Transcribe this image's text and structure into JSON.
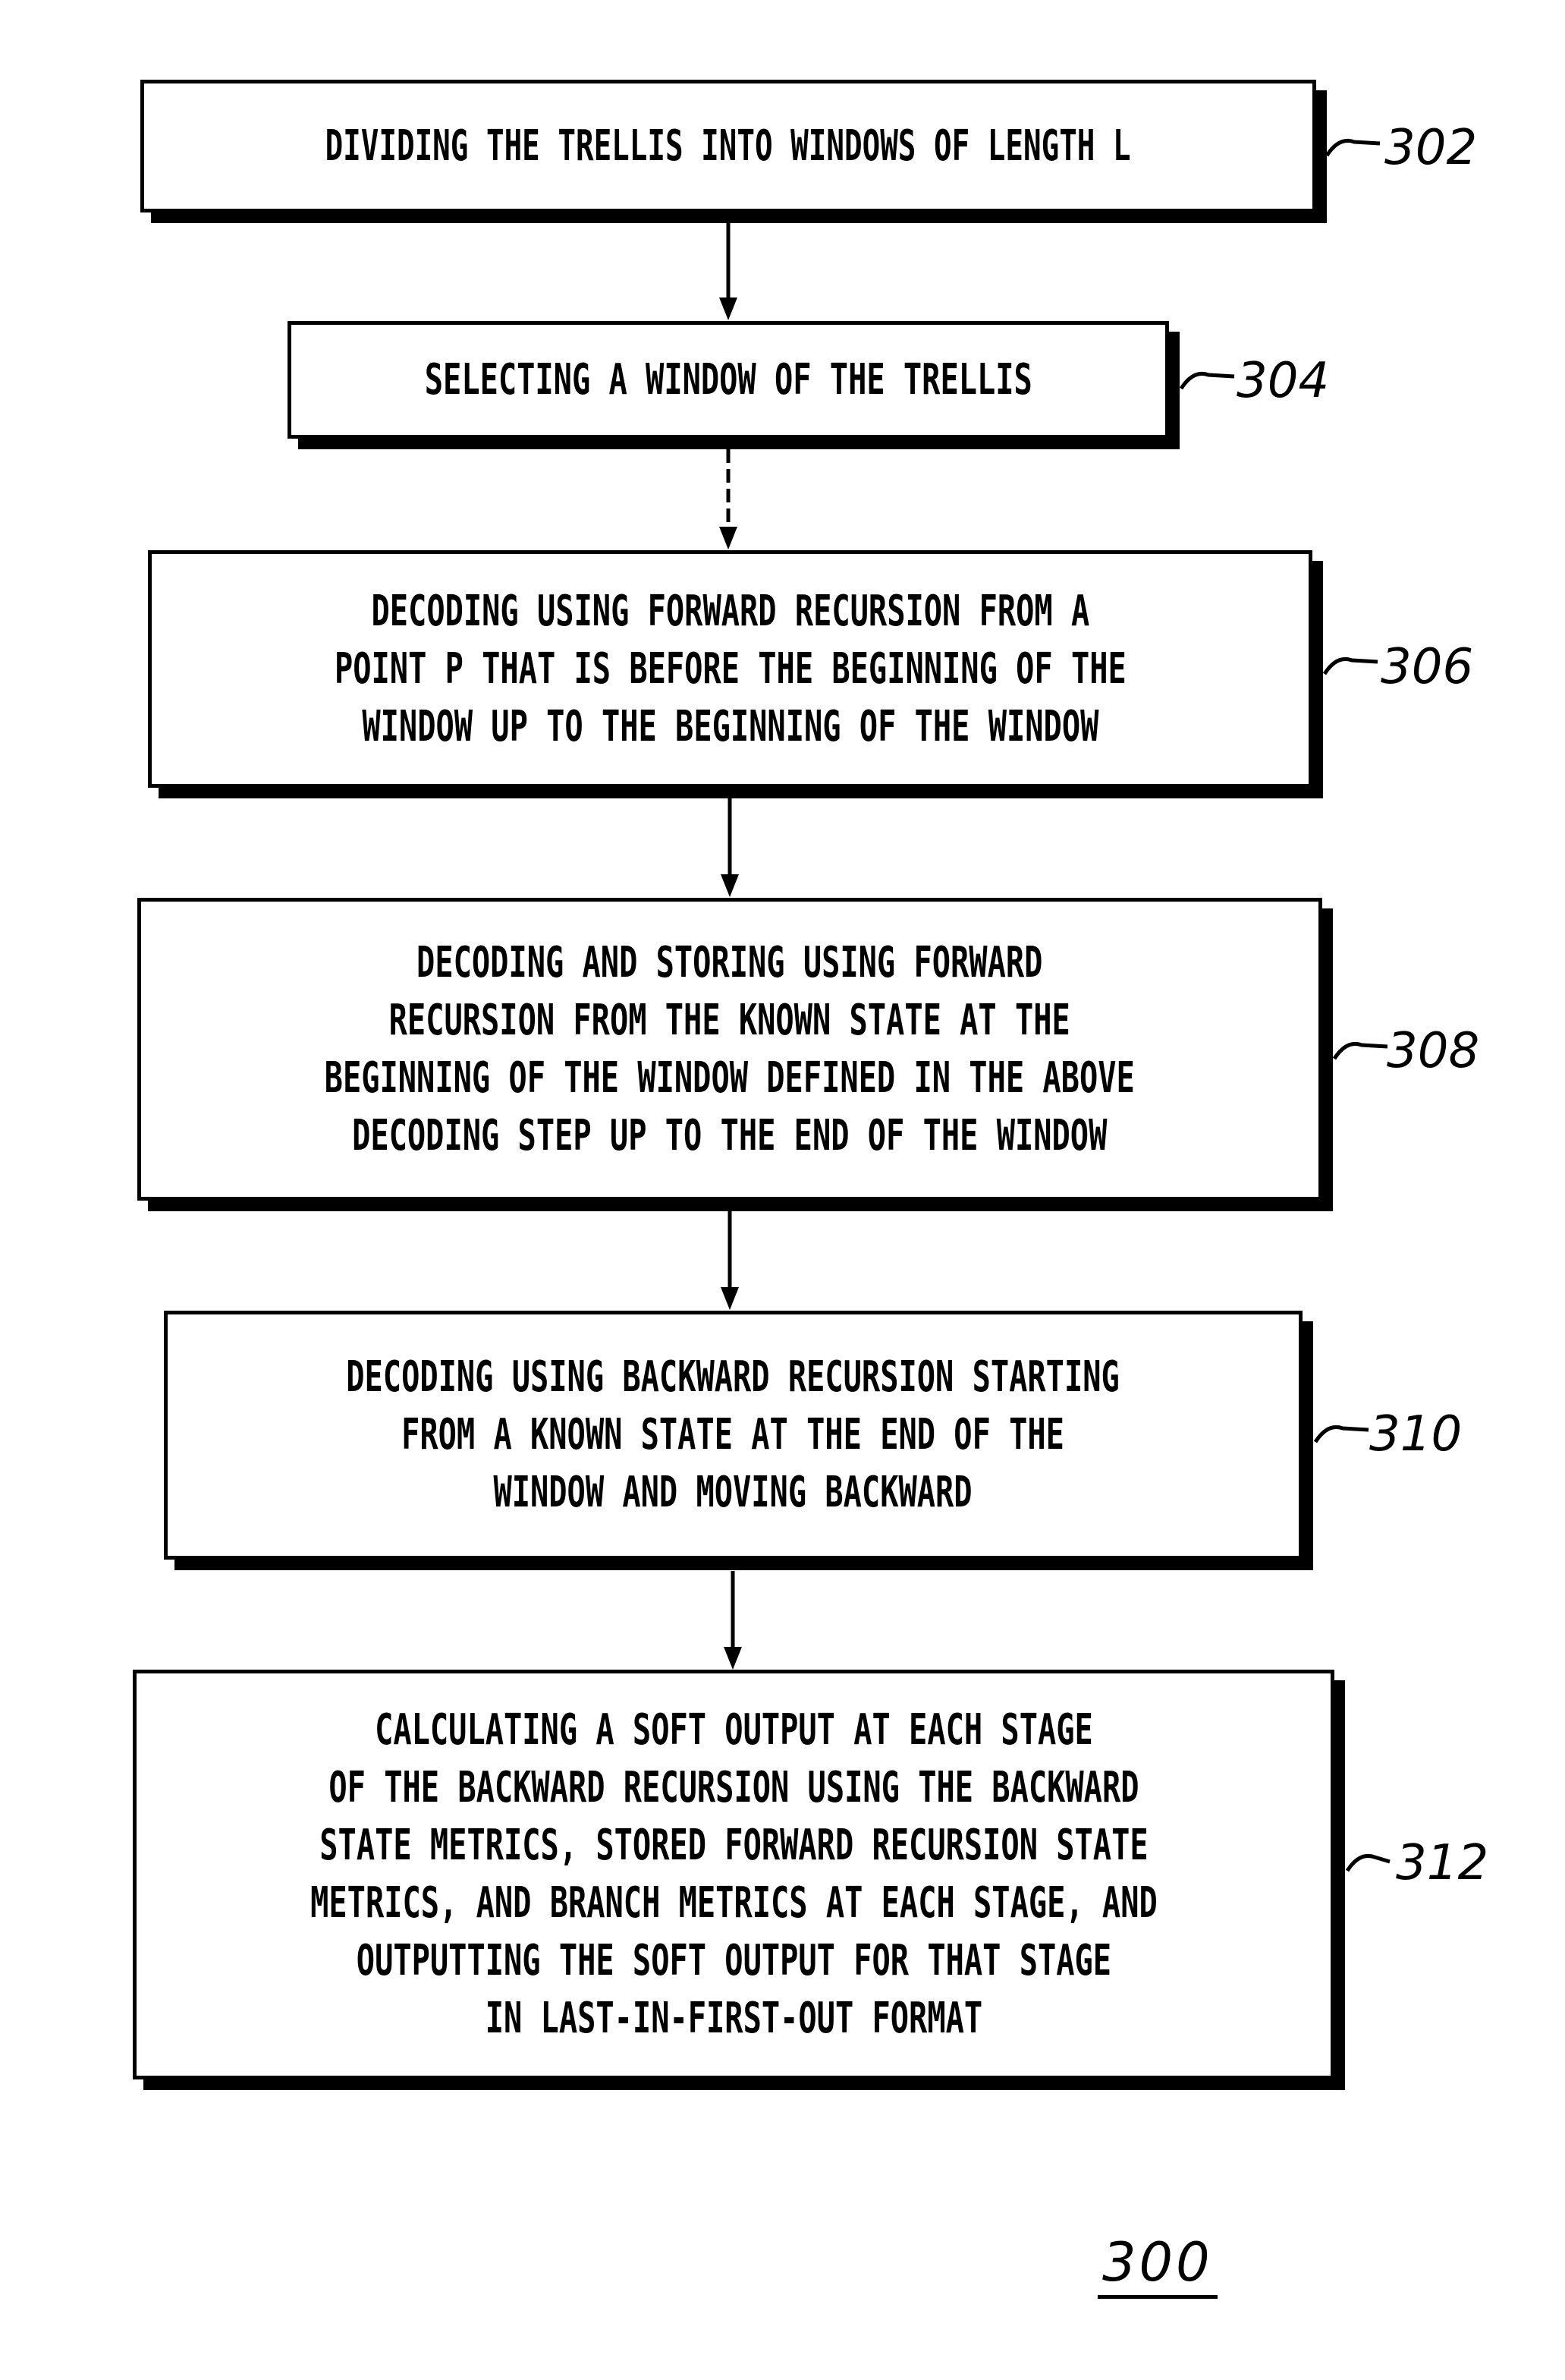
{
  "figure": {
    "label": "300",
    "steps": [
      {
        "ref": "302",
        "text": "DIVIDING THE TRELLIS INTO WINDOWS OF LENGTH L"
      },
      {
        "ref": "304",
        "text": "SELECTING A WINDOW OF THE TRELLIS"
      },
      {
        "ref": "306",
        "text": "DECODING USING FORWARD RECURSION FROM A\nPOINT P THAT IS BEFORE THE BEGINNING OF THE\nWINDOW UP TO THE BEGINNING OF THE WINDOW"
      },
      {
        "ref": "308",
        "text": "DECODING AND STORING USING FORWARD\nRECURSION FROM THE KNOWN STATE AT THE\nBEGINNING OF THE WINDOW DEFINED IN THE ABOVE\nDECODING STEP UP TO THE END OF THE WINDOW"
      },
      {
        "ref": "310",
        "text": "DECODING USING BACKWARD RECURSION STARTING\nFROM A KNOWN STATE AT THE END OF THE\nWINDOW AND MOVING BACKWARD"
      },
      {
        "ref": "312",
        "text": "CALCULATING A SOFT OUTPUT AT EACH STAGE\nOF THE BACKWARD RECURSION USING THE BACKWARD\nSTATE METRICS, STORED FORWARD RECURSION STATE\nMETRICS, AND BRANCH METRICS AT EACH STAGE, AND\nOUTPUTTING THE SOFT OUTPUT FOR THAT STAGE\nIN LAST-IN-FIRST-OUT FORMAT"
      }
    ]
  }
}
